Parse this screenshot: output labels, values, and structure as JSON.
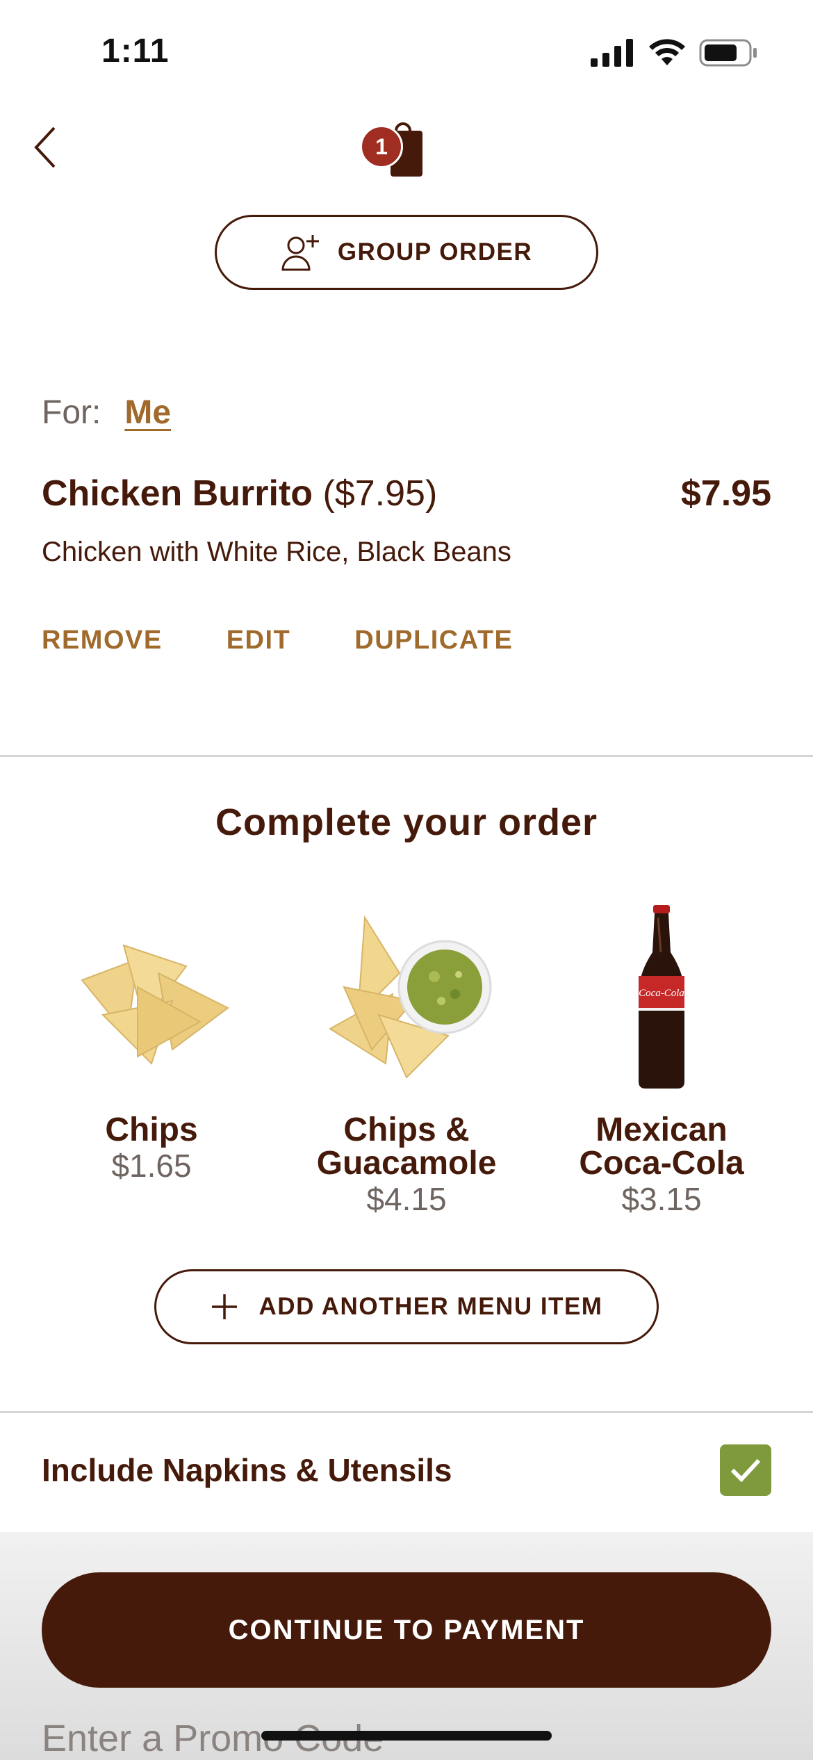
{
  "status_bar": {
    "time": "1:11",
    "icons": [
      "signal-icon",
      "wifi-icon",
      "battery-icon"
    ]
  },
  "header": {
    "back_icon": "chevron-left-icon",
    "bag_icon": "bag-icon",
    "bag_count": "1",
    "group_order_label": "GROUP ORDER",
    "group_order_icon": "person-add-icon"
  },
  "order": {
    "for_label": "For:",
    "for_value": "Me",
    "item": {
      "name": "Chicken Burrito",
      "unit_price": "($7.95)",
      "total": "$7.95",
      "description": "Chicken with White Rice, Black Beans"
    },
    "actions": {
      "remove": "REMOVE",
      "edit": "EDIT",
      "duplicate": "DUPLICATE"
    }
  },
  "upsell": {
    "title": "Complete your order",
    "items": [
      {
        "name_line1": "Chips",
        "name_line2": "",
        "price": "$1.65",
        "icon": "chips-icon"
      },
      {
        "name_line1": "Chips &",
        "name_line2": "Guacamole",
        "price": "$4.15",
        "icon": "chips-guacamole-icon"
      },
      {
        "name_line1": "Mexican",
        "name_line2": "Coca-Cola",
        "price": "$3.15",
        "icon": "coca-cola-bottle-icon"
      }
    ],
    "bottle_label": "Coca-Cola",
    "add_item_label": "ADD ANOTHER MENU ITEM"
  },
  "napkins": {
    "label": "Include Napkins & Utensils",
    "checked": true
  },
  "footer": {
    "continue_label": "CONTINUE TO PAYMENT",
    "promo_placeholder": "Enter a Promo Code"
  },
  "colors": {
    "brand_brown": "#451a0a",
    "accent_gold": "#a06a2c",
    "badge_red": "#a02d22",
    "check_green": "#7f9a3c"
  }
}
